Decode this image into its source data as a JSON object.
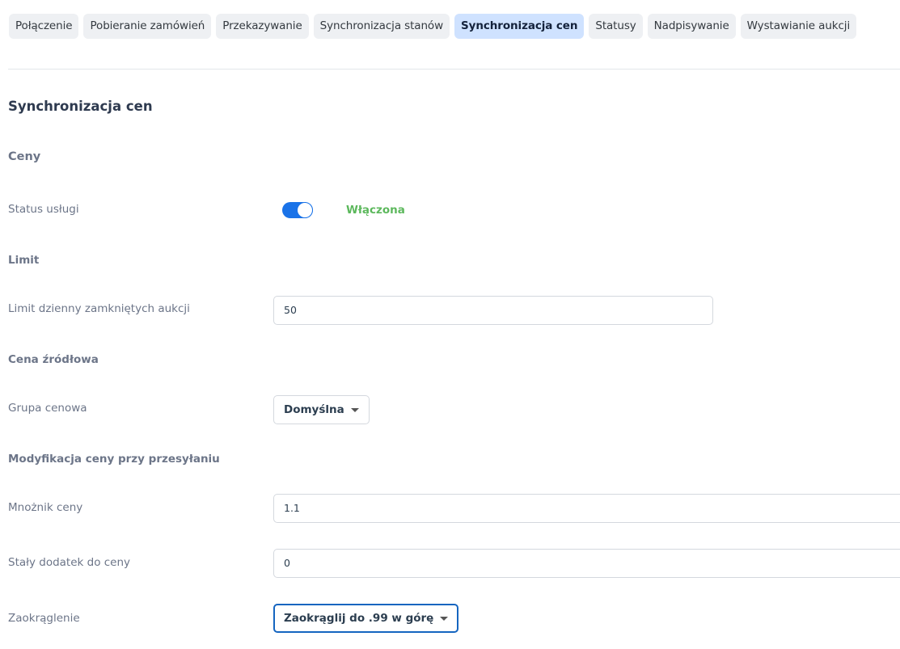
{
  "tabs": [
    {
      "label": "Połączenie"
    },
    {
      "label": "Pobieranie zamówień"
    },
    {
      "label": "Przekazywanie"
    },
    {
      "label": "Synchronizacja stanów"
    },
    {
      "label": "Synchronizacja cen",
      "active": true
    },
    {
      "label": "Statusy"
    },
    {
      "label": "Nadpisywanie"
    },
    {
      "label": "Wystawianie aukcji"
    }
  ],
  "page": {
    "title": "Synchronizacja cen"
  },
  "prices": {
    "section_title": "Ceny",
    "service_status_label": "Status usługi",
    "service_status_value": "Włączona",
    "service_enabled": true
  },
  "limit": {
    "group_title": "Limit",
    "daily_label": "Limit dzienny zamkniętych aukcji",
    "daily_value": "50"
  },
  "source_price": {
    "group_title": "Cena źródłowa",
    "price_group_label": "Grupa cenowa",
    "price_group_value": "Domyślna"
  },
  "modification": {
    "group_title": "Modyfikacja ceny przy przesyłaniu",
    "multiplier_label": "Mnożnik ceny",
    "multiplier_value": "1.1",
    "addition_label": "Stały dodatek do ceny",
    "addition_value": "0",
    "rounding_label": "Zaokrąglenie",
    "rounding_value": "Zaokrąglij do .99 w górę"
  },
  "colors": {
    "accent": "#1a73e8",
    "active_tab_bg": "#cfe2ff",
    "status_on": "#5cb85c"
  }
}
